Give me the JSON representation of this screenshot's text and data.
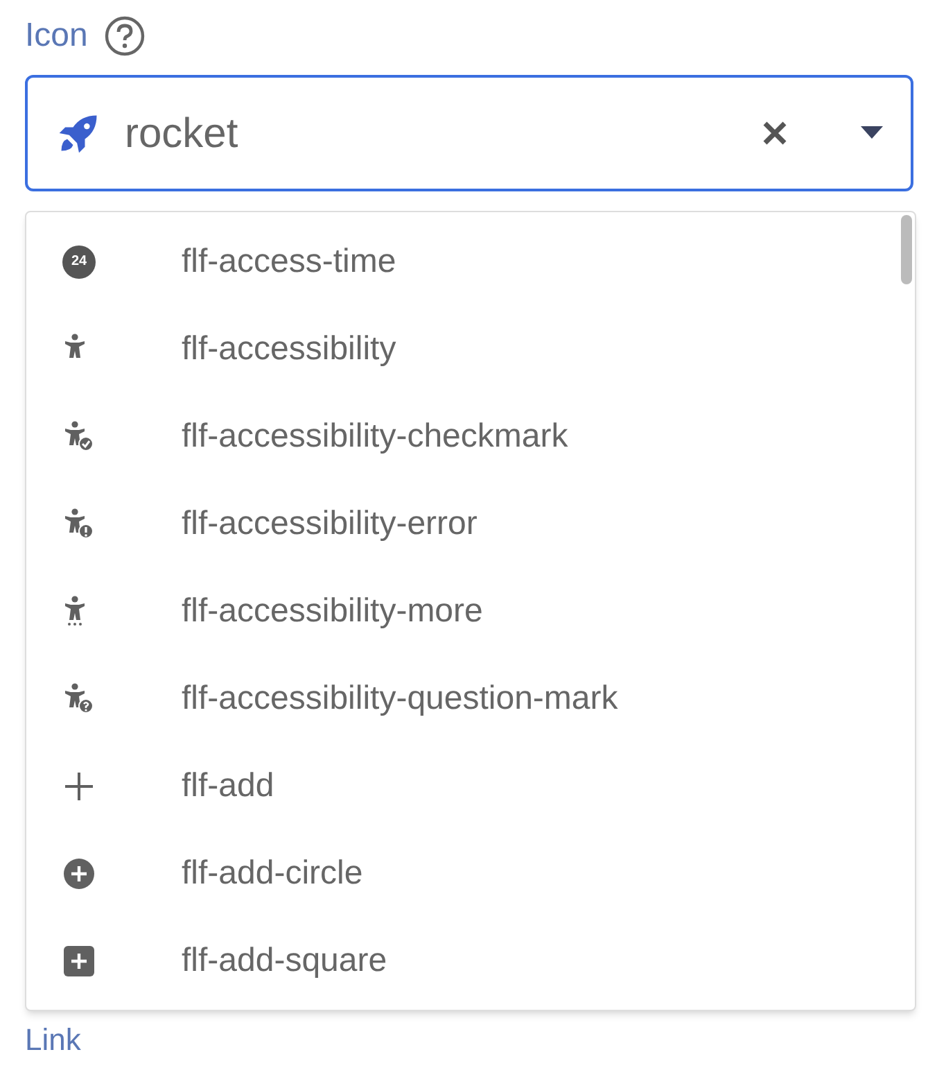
{
  "field": {
    "label": "Icon",
    "value": "rocket"
  },
  "options": [
    {
      "kind": "clock24",
      "label": "flf-access-time",
      "badge": "24"
    },
    {
      "kind": "person",
      "label": "flf-accessibility"
    },
    {
      "kind": "person-check",
      "label": "flf-accessibility-checkmark"
    },
    {
      "kind": "person-error",
      "label": "flf-accessibility-error"
    },
    {
      "kind": "person-more",
      "label": "flf-accessibility-more"
    },
    {
      "kind": "person-question",
      "label": "flf-accessibility-question-mark"
    },
    {
      "kind": "plus",
      "label": "flf-add"
    },
    {
      "kind": "plus-circle",
      "label": "flf-add-circle"
    },
    {
      "kind": "plus-square",
      "label": "flf-add-square"
    }
  ],
  "next_label": "Link"
}
